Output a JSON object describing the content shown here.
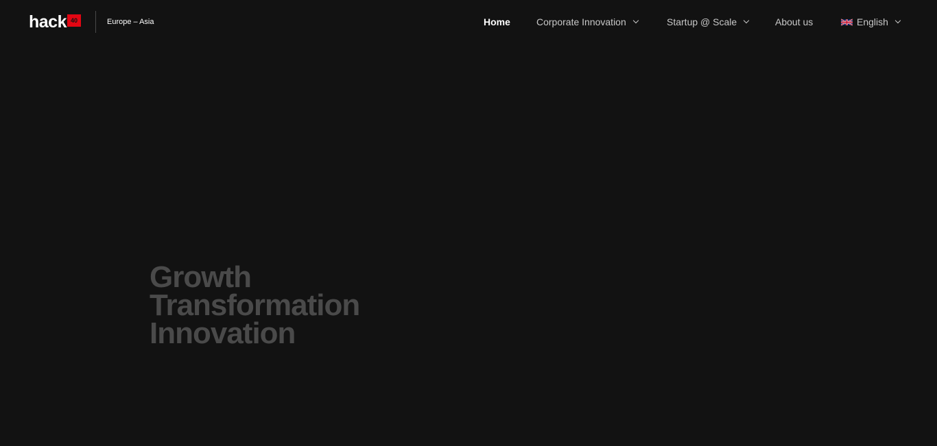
{
  "header": {
    "logo": {
      "word": "hack",
      "badge": "40"
    },
    "region": "Europe – Asia"
  },
  "nav": {
    "items": [
      {
        "label": "Home",
        "active": true,
        "has_dropdown": false
      },
      {
        "label": "Corporate Innovation",
        "active": false,
        "has_dropdown": true
      },
      {
        "label": "Startup @ Scale",
        "active": false,
        "has_dropdown": true
      },
      {
        "label": "About us",
        "active": false,
        "has_dropdown": false
      }
    ],
    "language": {
      "label": "English",
      "icon": "uk-flag-icon",
      "has_dropdown": true
    }
  },
  "hero": {
    "lines": [
      "Growth",
      "Transformation",
      "Innovation"
    ]
  },
  "colors": {
    "background": "#121212",
    "accent": "#e30613",
    "nav_text": "#c8c8c8",
    "hero_text": "#4a4a4a"
  }
}
